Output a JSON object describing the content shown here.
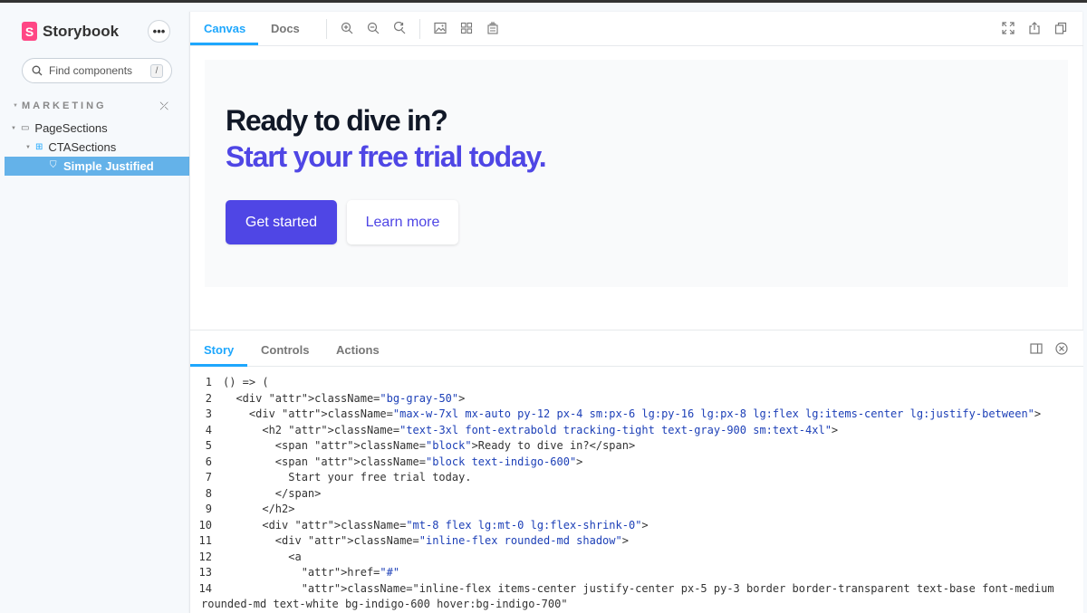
{
  "brand": {
    "logo_letter": "S",
    "name": "Storybook",
    "menu_label": "•••"
  },
  "search": {
    "placeholder": "Find components",
    "shortcut": "/"
  },
  "sidebar": {
    "section_title": "MARKETING",
    "collapse_label": "⤫",
    "items": [
      {
        "label": "PageSections",
        "icon": "folder-icon"
      },
      {
        "label": "CTASections",
        "icon": "component-icon"
      },
      {
        "label": "Simple Justified",
        "icon": "bookmark-icon",
        "selected": true
      }
    ]
  },
  "toolbar": {
    "tabs": [
      {
        "label": "Canvas",
        "active": true
      },
      {
        "label": "Docs",
        "active": false
      }
    ]
  },
  "preview": {
    "heading_line1": "Ready to dive in?",
    "heading_line2": "Start your free trial today.",
    "primary_button": "Get started",
    "secondary_button": "Learn more",
    "colors": {
      "accent": "#4f46e5",
      "heading": "#111827",
      "background": "#f9fafb"
    }
  },
  "addons": {
    "tabs": [
      {
        "label": "Story",
        "active": true
      },
      {
        "label": "Controls",
        "active": false
      },
      {
        "label": "Actions",
        "active": false
      }
    ]
  },
  "code_lines": [
    "() => (",
    "  <div className=\"bg-gray-50\">",
    "    <div className=\"max-w-7xl mx-auto py-12 px-4 sm:px-6 lg:py-16 lg:px-8 lg:flex lg:items-center lg:justify-between\">",
    "      <h2 className=\"text-3xl font-extrabold tracking-tight text-gray-900 sm:text-4xl\">",
    "        <span className=\"block\">Ready to dive in?</span>",
    "        <span className=\"block text-indigo-600\">",
    "          Start your free trial today.",
    "        </span>",
    "      </h2>",
    "      <div className=\"mt-8 flex lg:mt-0 lg:flex-shrink-0\">",
    "        <div className=\"inline-flex rounded-md shadow\">",
    "          <a",
    "            href=\"#\"",
    "            className=\"inline-flex items-center justify-center px-5 py-3 border border-transparent text-base font-medium",
    "rounded-md text-white bg-indigo-600 hover:bg-indigo-700\""
  ],
  "line_numbers": [
    "1",
    "2",
    "3",
    "4",
    "5",
    "6",
    "7",
    "8",
    "9",
    "10",
    "11",
    "12",
    "13",
    "14",
    ""
  ]
}
